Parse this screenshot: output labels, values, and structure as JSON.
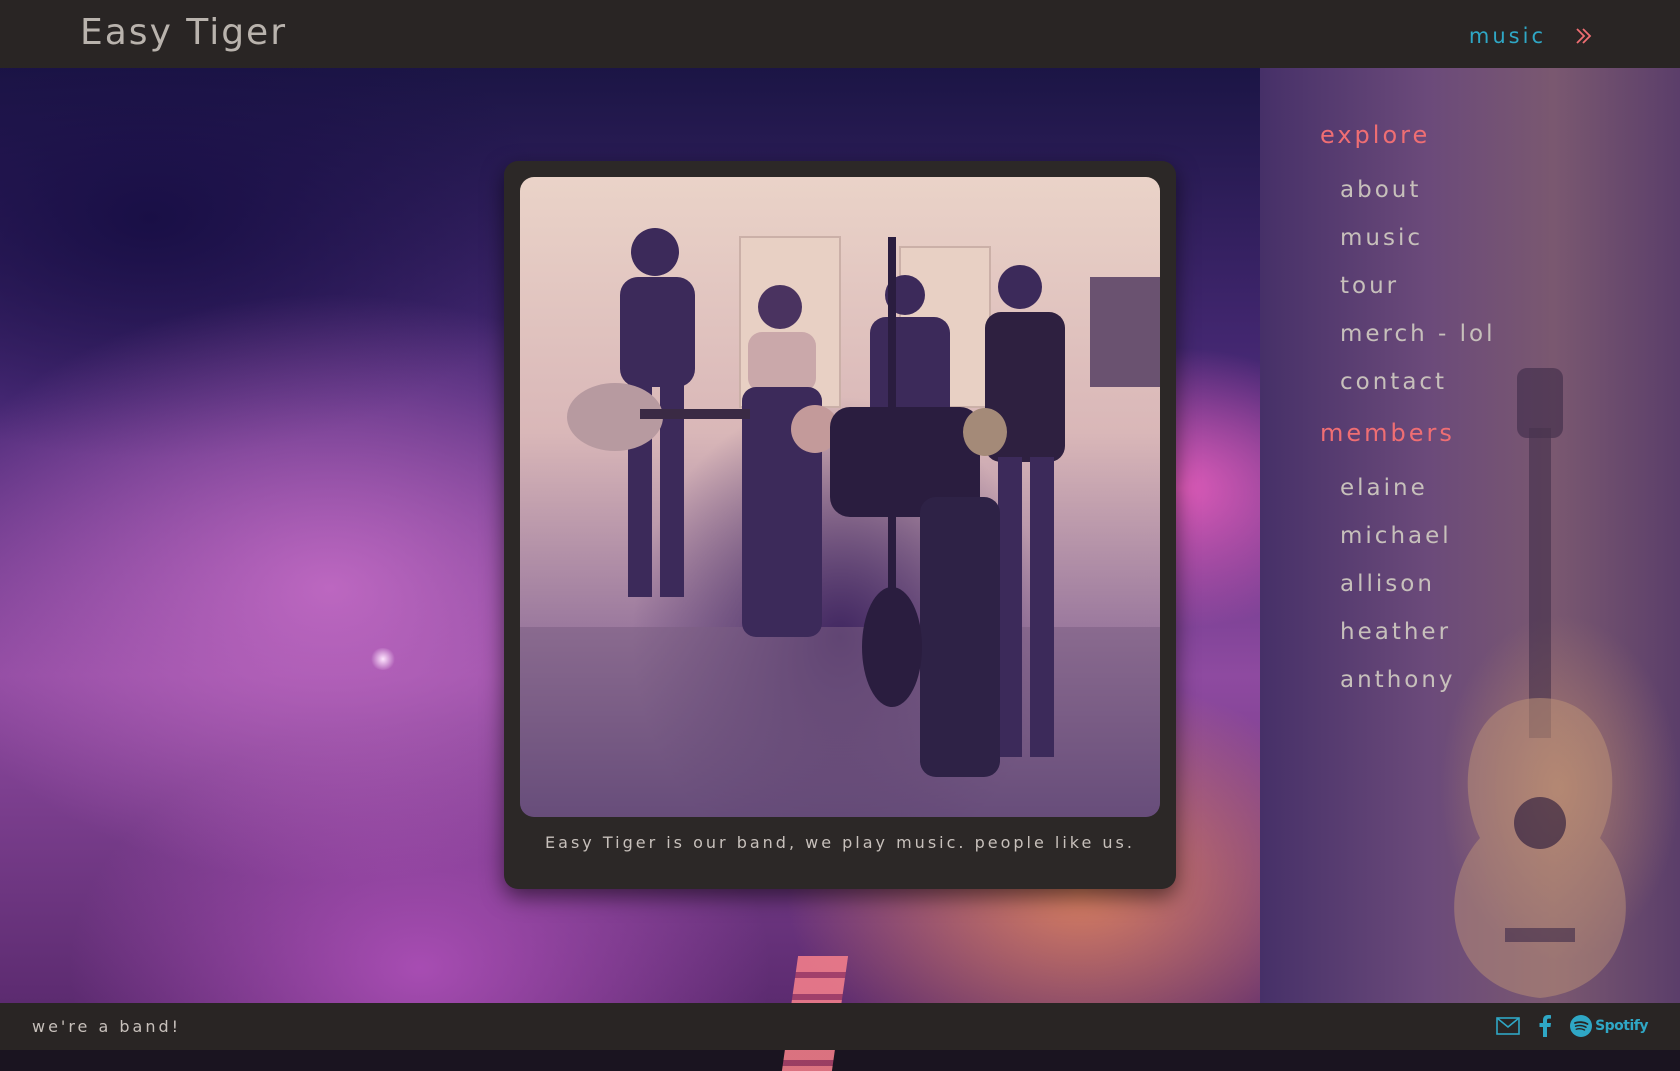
{
  "header": {
    "title": "Easy Tiger",
    "nav_link": "music",
    "toggle_icon": "double-chevron-right-icon"
  },
  "colors": {
    "accent_cyan": "#2fa7c5",
    "accent_coral": "#ef6e73",
    "bar_bg": "#292524",
    "text_light": "#c7c0bb"
  },
  "sidebar": {
    "sections": [
      {
        "heading": "explore",
        "items": [
          {
            "label": "about"
          },
          {
            "label": "music"
          },
          {
            "label": "tour"
          },
          {
            "label": "merch - lol"
          },
          {
            "label": "contact"
          }
        ]
      },
      {
        "heading": "members",
        "items": [
          {
            "label": "elaine"
          },
          {
            "label": "michael"
          },
          {
            "label": "allison"
          },
          {
            "label": "heather"
          },
          {
            "label": "anthony"
          }
        ]
      }
    ]
  },
  "main": {
    "caption": "Easy Tiger is our band, we play music. people like us."
  },
  "footer": {
    "tagline": "we're a band!",
    "icons": [
      "mail-icon",
      "facebook-icon",
      "spotify-icon"
    ],
    "spotify_label": "Spotify"
  }
}
